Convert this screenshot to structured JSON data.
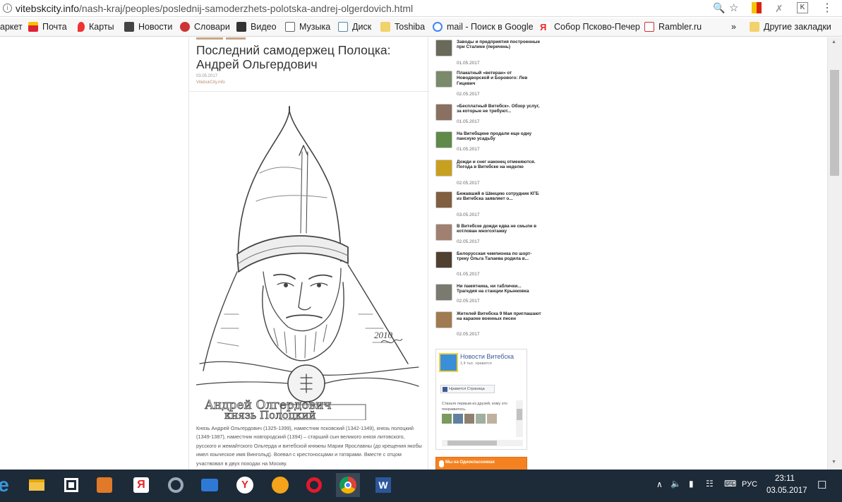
{
  "browser": {
    "url_host": "vitebskcity.info",
    "url_path": "/nash-kraj/peoples/poslednij-samoderzhets-polotska-andrej-olgerdovich.html"
  },
  "bookmarks": [
    {
      "label": "аркет"
    },
    {
      "label": "Почта"
    },
    {
      "label": "Карты"
    },
    {
      "label": "Новости"
    },
    {
      "label": "Словари"
    },
    {
      "label": "Видео"
    },
    {
      "label": "Музыка"
    },
    {
      "label": "Диск"
    },
    {
      "label": "Toshiba"
    },
    {
      "label": "mail - Поиск в Google"
    },
    {
      "label": "Собор Псково-Печер"
    },
    {
      "label": "Rambler.ru"
    },
    {
      "label": "»"
    },
    {
      "label": "Другие закладки"
    }
  ],
  "article": {
    "title": "Последний самодержец Полоцка: Андрей Ольгердович",
    "date": "03.05.2017",
    "source": "VitebskCity.info",
    "sketch_signature": "2010",
    "sketch_caption_line1": "Андрей Олгердович",
    "sketch_caption_line2": "князь Полоцкий",
    "paragraph": "Князь Андрей Ольгердович (1325-1399), наместник псковский (1342-1349), князь полоцкий (1349-1387), наместник новгородский (1394) – старший сын великого князя литовского, русского и жемайтского Ольгерда и витебской княжны Марии Ярославны (до крещения якобы имел языческое имя Вингольд). Воевал с крестоносцами и татарами. Вместе с отцом участвовал в двух походах на Москву."
  },
  "news": [
    {
      "title": "Заводы и предприятия построенные при Сталине (перечень)",
      "date": "01.05.2017",
      "color": "#6a6a5a"
    },
    {
      "title": "Плакатный «ветеран» от Новодворской и Борового: Лев Гицевич",
      "date": "02.05.2017",
      "color": "#7a8a6a"
    },
    {
      "title": "«Бесплатный Витебск». Обзор услуг, за которые не требуют...",
      "date": "01.05.2017",
      "color": "#8a7060"
    },
    {
      "title": "На Витебщине продали еще одну панскую усадьбу",
      "date": "01.05.2017",
      "color": "#5f8a4a"
    },
    {
      "title": "Дожди и снег наконец отменяются. Погода в Витебске на неделю",
      "date": "02.05.2017",
      "color": "#c8a020"
    },
    {
      "title": "Бежавший в Швецию сотрудник КГБ из Витебска заявляет о...",
      "date": "03.05.2017",
      "color": "#806040"
    },
    {
      "title": "В Витебске дожди едва не смыли в котлован многоэтажку",
      "date": "02.05.2017",
      "color": "#a08070"
    },
    {
      "title": "Белорусская чемпионка по шорт-треку Ольга Талаева родила в...",
      "date": "01.05.2017",
      "color": "#504030"
    },
    {
      "title": "Ни памятника, ни таблички... Трагедия на станции Крынковка",
      "date": "02.05.2017",
      "color": "#7a7a70"
    },
    {
      "title": "Жителей Витебска 9 Мая приглашают на караоке военных песен",
      "date": "02.05.2017",
      "color": "#a07a50"
    }
  ],
  "fb_widget": {
    "page_name": "Новости Витебска",
    "likes": "1,4 тыс. нравится",
    "like_button": "Нравится Страница",
    "friends_text": "Станьте первым из друзей, кому это понравилось."
  },
  "ok_widget": {
    "label": "Мы на Одноклассниках"
  },
  "tray": {
    "lang": "РУС",
    "time": "23:11",
    "date": "03.05.2017"
  }
}
